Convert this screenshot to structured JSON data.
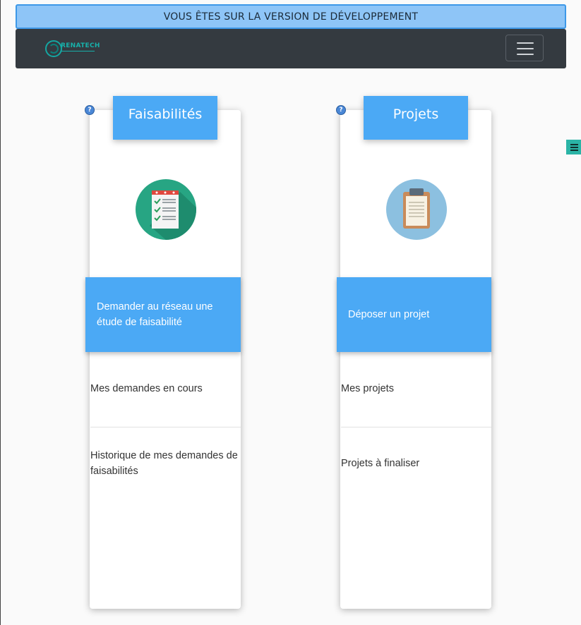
{
  "banner": {
    "text": "VOUS ÊTES SUR LA VERSION DE DÉVELOPPEMENT"
  },
  "navbar": {
    "logo_text": "RENATECH",
    "menu_icon": "hamburger-icon"
  },
  "side_handle": {
    "icon": "menu-lines-icon"
  },
  "help_icon_glyph": "?",
  "colors": {
    "accent": "#4ba9f5",
    "navbar": "#343a40",
    "banner": "#8ec5f7",
    "logo": "#18b0aa"
  },
  "cards": [
    {
      "title": "Faisabilités",
      "icon": "checklist-icon",
      "action": "Demander au réseau une étude de faisabilité",
      "links": [
        "Mes demandes en cours",
        "Historique de mes demandes de faisabilités"
      ]
    },
    {
      "title": "Projets",
      "icon": "clipboard-icon",
      "action": "Déposer un projet",
      "links": [
        "Mes projets",
        "Projets à finaliser"
      ]
    }
  ]
}
